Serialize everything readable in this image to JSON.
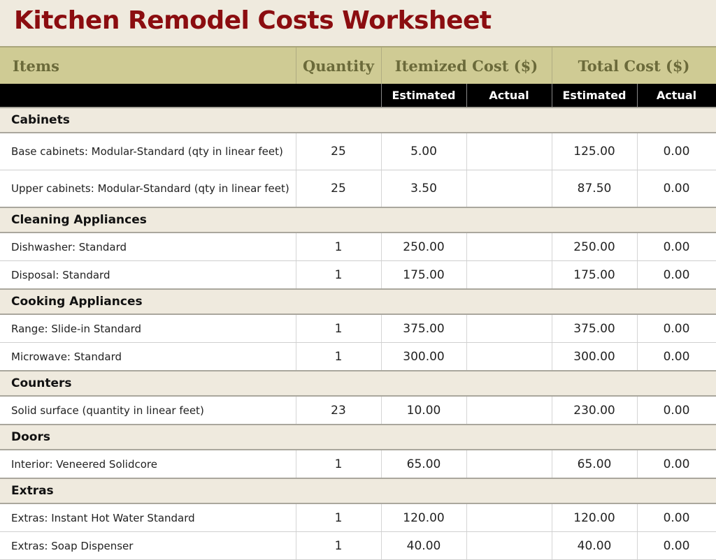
{
  "title": "Kitchen Remodel Costs Worksheet",
  "headers": {
    "items": "Items",
    "quantity": "Quantity",
    "itemized": "Itemized Cost ($)",
    "total": "Total Cost ($)",
    "estimated": "Estimated",
    "actual": "Actual"
  },
  "categories": [
    {
      "name": "Cabinets",
      "rows": [
        {
          "item": "Base cabinets: Modular-Standard (qty in linear feet)",
          "qty": "25",
          "est": "5.00",
          "act": "",
          "tot_est": "125.00",
          "tot_act": "0.00"
        },
        {
          "item": "Upper cabinets: Modular-Standard (qty in linear feet)",
          "qty": "25",
          "est": "3.50",
          "act": "",
          "tot_est": "87.50",
          "tot_act": "0.00"
        }
      ]
    },
    {
      "name": "Cleaning Appliances",
      "rows": [
        {
          "item": "Dishwasher: Standard",
          "qty": "1",
          "est": "250.00",
          "act": "",
          "tot_est": "250.00",
          "tot_act": "0.00"
        },
        {
          "item": "Disposal: Standard",
          "qty": "1",
          "est": "175.00",
          "act": "",
          "tot_est": "175.00",
          "tot_act": "0.00"
        }
      ]
    },
    {
      "name": "Cooking Appliances",
      "rows": [
        {
          "item": "Range: Slide-in Standard",
          "qty": "1",
          "est": "375.00",
          "act": "",
          "tot_est": "375.00",
          "tot_act": "0.00"
        },
        {
          "item": "Microwave: Standard",
          "qty": "1",
          "est": "300.00",
          "act": "",
          "tot_est": "300.00",
          "tot_act": "0.00"
        }
      ]
    },
    {
      "name": "Counters",
      "rows": [
        {
          "item": "Solid surface (quantity in linear feet)",
          "qty": "23",
          "est": "10.00",
          "act": "",
          "tot_est": "230.00",
          "tot_act": "0.00"
        }
      ]
    },
    {
      "name": "Doors",
      "rows": [
        {
          "item": "Interior: Veneered Solidcore",
          "qty": "1",
          "est": "65.00",
          "act": "",
          "tot_est": "65.00",
          "tot_act": "0.00"
        }
      ]
    },
    {
      "name": "Extras",
      "rows": [
        {
          "item": "Extras: Instant Hot Water Standard",
          "qty": "1",
          "est": "120.00",
          "act": "",
          "tot_est": "120.00",
          "tot_act": "0.00"
        },
        {
          "item": "Extras: Soap Dispenser",
          "qty": "1",
          "est": "40.00",
          "act": "",
          "tot_est": "40.00",
          "tot_act": "0.00"
        }
      ]
    }
  ]
}
